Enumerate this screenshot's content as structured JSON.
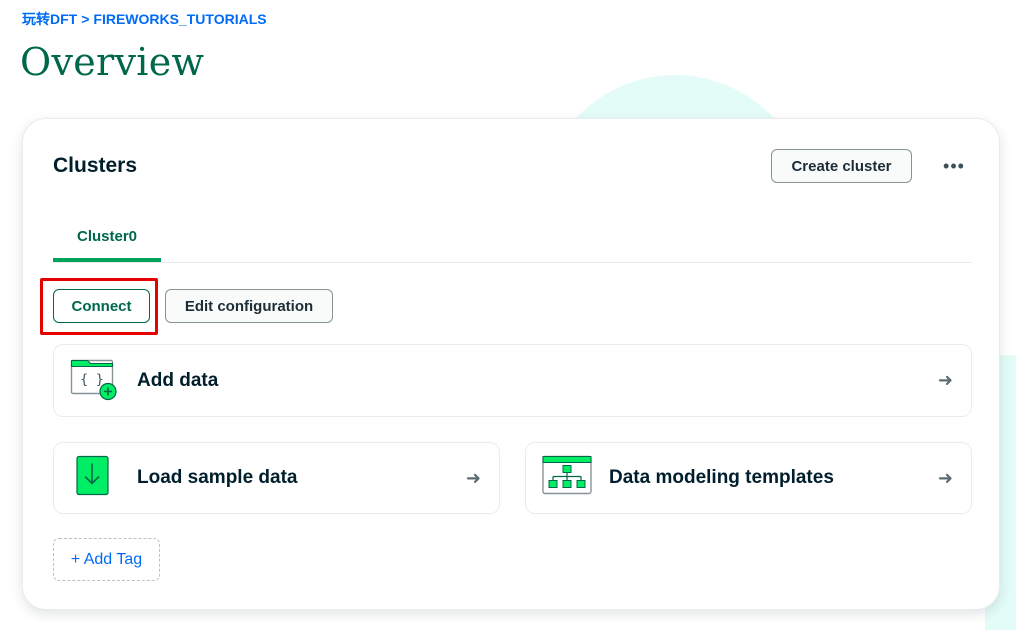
{
  "breadcrumb": {
    "org": "玩转DFT",
    "separator": ">",
    "project": "FIREWORKS_TUTORIALS"
  },
  "page": {
    "title": "Overview"
  },
  "clusters": {
    "title": "Clusters",
    "create_label": "Create cluster",
    "more_label": "•••",
    "tabs": [
      {
        "label": "Cluster0",
        "active": true
      }
    ],
    "actions": {
      "connect_label": "Connect",
      "edit_label": "Edit configuration"
    },
    "tiles": [
      {
        "label": "Add data",
        "icon": "add-data-icon"
      },
      {
        "label": "Load sample data",
        "icon": "load-sample-data-icon"
      },
      {
        "label": "Data modeling templates",
        "icon": "data-modeling-icon"
      }
    ],
    "arrow": "➜",
    "add_tag_label": "+ Add Tag"
  },
  "colors": {
    "brand_green": "#00684a",
    "accent_green": "#00ed64",
    "link_blue": "#016bf8",
    "highlight_red": "#e60000",
    "mint_background": "#e3fcf7"
  }
}
